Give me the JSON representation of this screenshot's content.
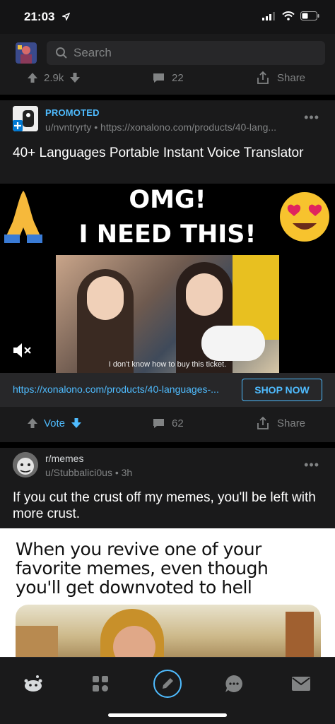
{
  "status": {
    "time": "21:03"
  },
  "search": {
    "placeholder": "Search"
  },
  "top_post_actions": {
    "score": "2.9k",
    "comments": "22",
    "share": "Share"
  },
  "ad_post": {
    "label": "PROMOTED",
    "meta": "u/nvntryrty • https://xonalono.com/products/40-lang...",
    "title": "40+ Languages Portable Instant Voice Translator",
    "media_text_line1": "OMG!",
    "media_text_line2": "I NEED THIS!",
    "video_subtitle": "I don't know how to buy this ticket.",
    "link": "https://xonalono.com/products/40-languages-...",
    "cta": "SHOP NOW",
    "vote_label": "Vote",
    "comments": "62",
    "share": "Share"
  },
  "meme_post": {
    "subreddit": "r/memes",
    "user": "u/Stubbalici0us",
    "age": "3h",
    "title": "If you cut the crust off my memes, you'll be left with more crust.",
    "caption": "When you revive one of your favorite memes, even though you'll get downvoted to hell"
  },
  "colors": {
    "accent": "#4fbcff",
    "card": "#1a1a1b",
    "muted": "#818384"
  },
  "tabs": [
    "home-icon",
    "communities-icon",
    "create-post-icon",
    "chat-icon",
    "inbox-icon"
  ]
}
